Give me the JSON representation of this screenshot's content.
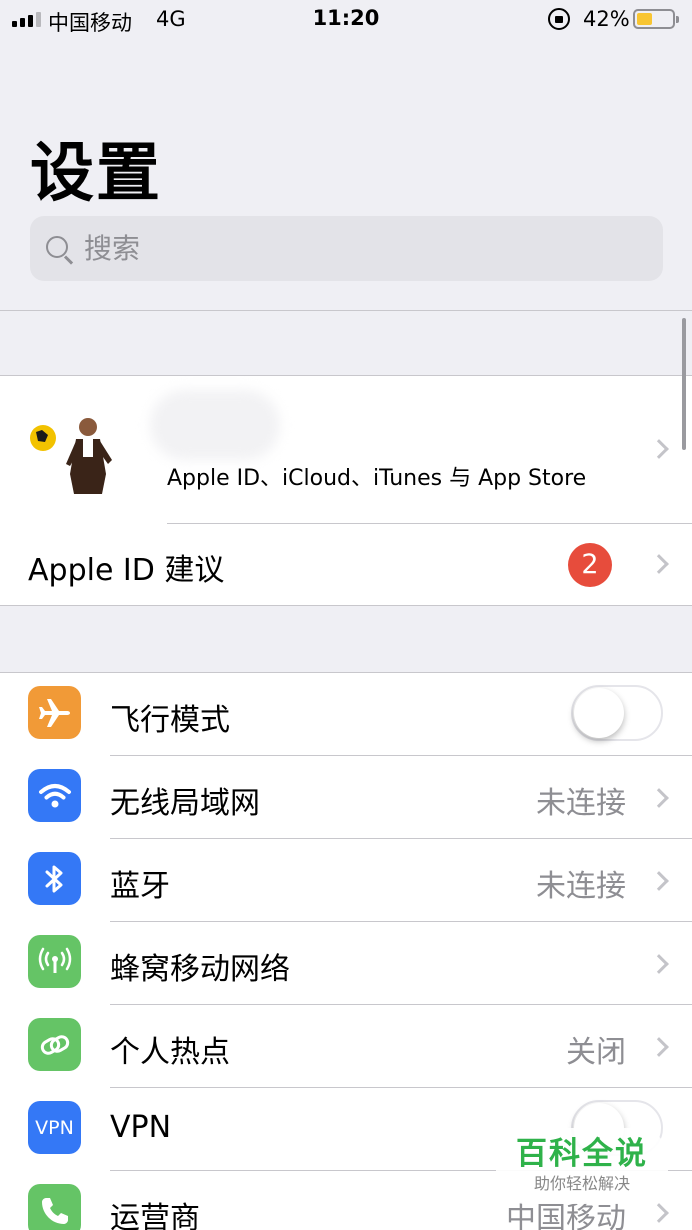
{
  "status_bar": {
    "carrier": "中国移动",
    "network": "4G",
    "time": "11:20",
    "battery_percent": "42%",
    "signal_bars_filled": 3,
    "signal_bars_total": 4,
    "battery_color": "#f8c532"
  },
  "page": {
    "title": "设置"
  },
  "search": {
    "placeholder": "搜索"
  },
  "account": {
    "subtitle": "Apple ID、iCloud、iTunes 与 App Store",
    "avatar_icon": "avatar-photo"
  },
  "suggestions": {
    "label": "Apple ID 建议",
    "badge": "2",
    "badge_color": "#e74c3c"
  },
  "settings": [
    {
      "name": "airplane",
      "label": "飞行模式",
      "value": "",
      "icon": "airplane-icon",
      "color": "#f19a37",
      "toggle": false
    },
    {
      "name": "wifi",
      "label": "无线局域网",
      "value": "未连接",
      "icon": "wifi-icon",
      "color": "#3478f6"
    },
    {
      "name": "bluetooth",
      "label": "蓝牙",
      "value": "未连接",
      "icon": "bluetooth-icon",
      "color": "#3478f6"
    },
    {
      "name": "cellular",
      "label": "蜂窝移动网络",
      "value": "",
      "icon": "antenna-icon",
      "color": "#65c466"
    },
    {
      "name": "hotspot",
      "label": "个人热点",
      "value": "关闭",
      "icon": "chain-link-icon",
      "color": "#65c466"
    },
    {
      "name": "vpn",
      "label": "VPN",
      "value": "",
      "icon": "vpn-icon",
      "icon_text": "VPN",
      "color": "#3478f6",
      "toggle": false
    },
    {
      "name": "carrier",
      "label": "运营商",
      "value": "中国移动",
      "icon": "phone-icon",
      "color": "#65c466"
    }
  ],
  "watermark": {
    "main": "百科全说",
    "sub": "助你轻松解决"
  }
}
